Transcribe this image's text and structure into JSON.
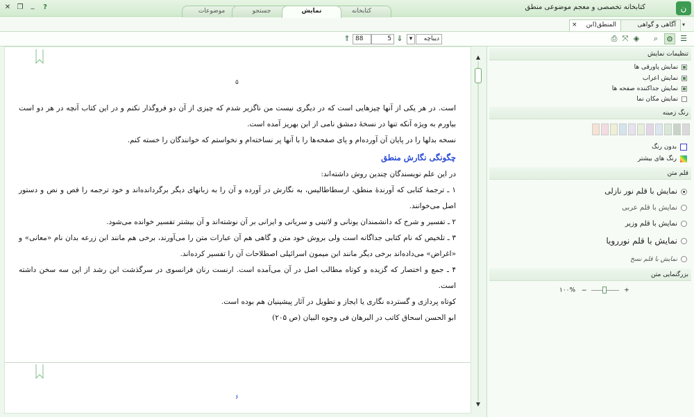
{
  "app": {
    "title": "کتابخانه تخصصی و معجم موضوعی منطق",
    "logo_glyph": "ن",
    "help": "?",
    "min": "_",
    "restore": "❐",
    "close": "✕"
  },
  "main_tabs": [
    {
      "label": "موضوعات"
    },
    {
      "label": "جستجو"
    },
    {
      "label": "نمایش"
    },
    {
      "label": "کتابخانه"
    }
  ],
  "book_tabs": [
    {
      "label": "المنطق(ابن مقفع)"
    },
    {
      "label": "آگاهی و گواهی"
    }
  ],
  "book_tab_close": "×",
  "toolbar": {
    "zoom_value": "88",
    "page_value": "5",
    "section_value": "دیباچه",
    "up_arrow": "⇑",
    "down_arrow": "⇓",
    "dropdown_arrow": "▾"
  },
  "document": {
    "page_number_top": "۵",
    "page_number_bottom": "۶",
    "paragraphs": [
      "است. در هر یکی از آنها چیزهایی است که در دیگری نیست من ناگزیر شدم که چیزی از آن دو فروگذار نکنم و در این کتاب آنچه در هر دو است بیاورم به ویژه آنکه تنها در نسخهٔ دمشق نامی از ابن بهریز آمده است.",
      "نسخه بدلها را در پایان آن آورده‌ام و پای صفحه‌ها را با آنها پر نساخته‌ام و نخواستم که خوانندگان را خسته کنم.",
      "در این علم نویسندگان چندین روش داشته‌اند:",
      "۱ ـ ترجمهٔ کتابی که آورندهٔ منطق، ارسطاطالیس، به نگارش در آورده و آن را به زبانهای دیگر برگردانده‌اند و خود ترجمه را فص و نص و دستور اصل می‌خوانند.",
      "۲ ـ تفسیر و شرح که دانشمندان یونانی و لاتینی و سریانی و ایرانی بر آن نوشته‌اند و آن بیشتر تفسیر خوانده می‌شود.",
      "۳ ـ تلخیص که نام کتابی جداگانه است ولی بروش خود متن و گاهی هم آن عبارات متن را می‌آورند، برخی هم مانند ابن زرعه بدان نام «معانی» و «اغراض» می‌داده‌اند برخی دیگر مانند ابن میمون اسرائیلی اصطلاحات آن را تفسیر کرده‌اند.",
      "۴ ـ جمع و اختصار که گزیده و کوتاه مطالب اصل در آن می‌آمده است. ارنست رنان فرانسوی در سرگذشت ابن رشد از این سه سخن داشته است.",
      "کوتاه پردازی و گسترده نگاری یا ایجاز و تطویل در آثار پیشینیان هم بوده است.",
      "ابو الحسن اسحاق کاتب در البرهان فی وجوه البیان (ص ۲۰۵)"
    ],
    "heading": "چگونگی نگارش منطق"
  },
  "panel": {
    "display_settings_title": "تنظیمات نمایش",
    "display_options": [
      {
        "label": "نمایش پاورقی ها",
        "checked": true
      },
      {
        "label": "نمایش اعراب",
        "checked": true
      },
      {
        "label": "نمایش جداکننده صفحه ها",
        "checked": true
      },
      {
        "label": "نمایش مکان نما",
        "checked": false
      }
    ],
    "bg_color_title": "رنگ زمینه",
    "swatches": [
      "#d9d9d9",
      "#c8d4c8",
      "#d8e8d8",
      "#dbe6ee",
      "#e3d6e8",
      "#e6efdc",
      "#e6e3ee",
      "#d4e4ec",
      "#eef0d4",
      "#f3dde0",
      "#f6e2d2"
    ],
    "no_color": "بدون رنگ",
    "more_colors": "رنگ های بیشتر",
    "font_title": "قلم متن",
    "fonts": [
      {
        "label": "نمایش با قلم نور نازلی",
        "selected": true
      },
      {
        "label": "نمایش با قلم عربی",
        "selected": false
      },
      {
        "label": "نمایش با قلم وزیر",
        "selected": false
      },
      {
        "label": "نمایش با قلم نوررویا",
        "selected": false
      },
      {
        "label": "نمایش با قلم نسخ",
        "selected": false
      }
    ],
    "zoom_title": "بزرگنمایی متن",
    "zoom_value": "۱۰۰%",
    "zoom_minus": "−",
    "zoom_plus": "+"
  }
}
